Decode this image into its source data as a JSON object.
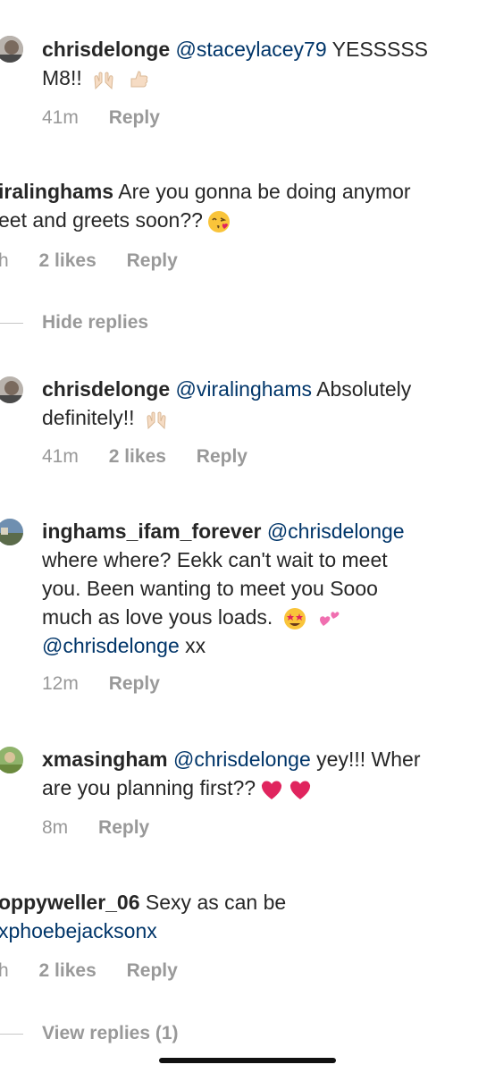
{
  "comments": [
    {
      "username": "chrisdelonge",
      "mention": "@staceylacey79",
      "text_line1": "YESSSSS",
      "text_line2": "M8!!",
      "emojis": [
        "raising-hands-icon",
        "thumbs-up-icon"
      ],
      "time": "41m",
      "reply_label": "Reply"
    },
    {
      "username": "iralinghams",
      "text_line1": "Are you gonna be doing anymor",
      "text_line2": "eet and greets soon??",
      "emojis": [
        "kiss-face-icon"
      ],
      "time": "h",
      "likes": "2 likes",
      "reply_label": "Reply",
      "toggle_label": "Hide replies"
    },
    {
      "username": "chrisdelonge",
      "mention": "@viralinghams",
      "text_line1": "Absolutely",
      "text_line2": "definitely!!",
      "emojis": [
        "raising-hands-icon"
      ],
      "time": "41m",
      "likes": "2 likes",
      "reply_label": "Reply"
    },
    {
      "username": "inghams_ifam_forever",
      "mention": "@chrisdelonge",
      "text_line2": "where where? Eekk can't wait to meet",
      "text_line3": "you. Been wanting to meet you Sooo",
      "text_line4": "much as love yous loads.",
      "text_line5_mention": "@chrisdelonge",
      "text_line5": "xx",
      "emojis": [
        "star-struck-icon",
        "two-hearts-icon"
      ],
      "time": "12m",
      "reply_label": "Reply"
    },
    {
      "username": "xmasingham",
      "mention": "@chrisdelonge",
      "text_line1": "yey!!! Wher",
      "text_line2": "are you planning first??",
      "emojis": [
        "red-heart-icon",
        "red-heart-icon"
      ],
      "time": "8m",
      "reply_label": "Reply"
    },
    {
      "username": "oppyweller_06",
      "text_line1": "Sexy as can be",
      "text_line2_mention": "xphoebejacksonx",
      "time": "h",
      "likes": "2 likes",
      "reply_label": "Reply",
      "toggle_label": "View replies (1)"
    }
  ],
  "colors": {
    "text": "#262626",
    "mention": "#003569",
    "meta": "#999999",
    "heart": "#e0245e"
  }
}
